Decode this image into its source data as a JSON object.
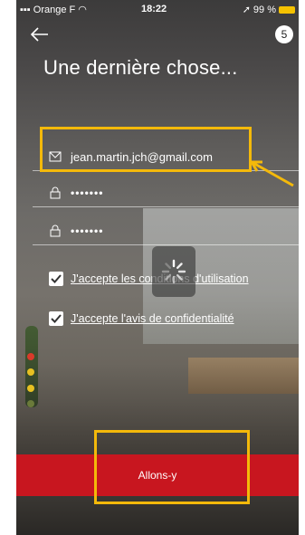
{
  "status_bar": {
    "carrier": "Orange F",
    "time": "18:22",
    "battery": "99 %"
  },
  "header": {
    "step": "5",
    "title": "Une dernière chose..."
  },
  "form": {
    "email_value": "jean.martin.jch@gmail.com",
    "password_mask": "•••••••",
    "password_confirm_mask": "•••••••"
  },
  "consents": {
    "terms_label": "J'accepte les conditions d'utilisation",
    "privacy_label": "J'accepte l'avis de confidentialité",
    "terms_checked": true,
    "privacy_checked": true
  },
  "cta": {
    "label": "Allons-y"
  },
  "colors": {
    "cta_red": "#c8161f",
    "highlight_yellow": "#f4b90a"
  }
}
